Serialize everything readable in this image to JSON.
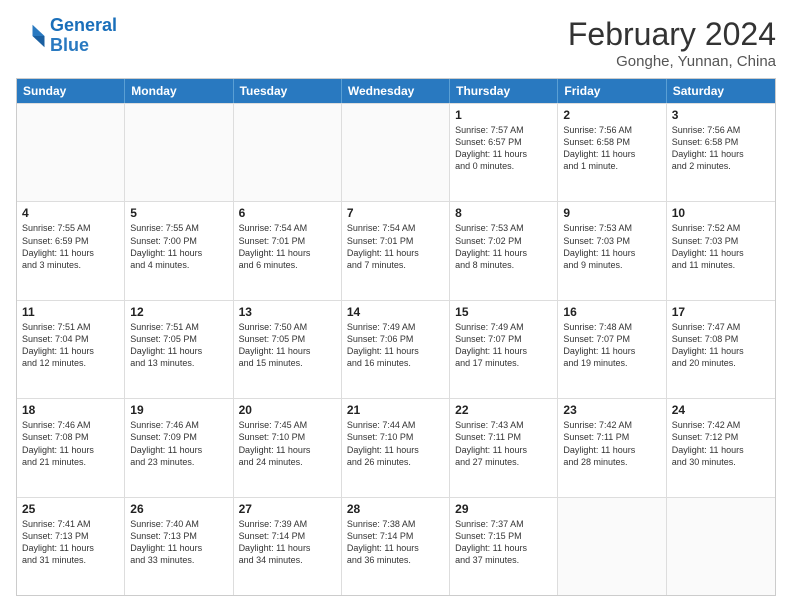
{
  "logo": {
    "line1": "General",
    "line2": "Blue"
  },
  "title": "February 2024",
  "subtitle": "Gonghe, Yunnan, China",
  "days_header": [
    "Sunday",
    "Monday",
    "Tuesday",
    "Wednesday",
    "Thursday",
    "Friday",
    "Saturday"
  ],
  "weeks": [
    [
      {
        "day": "",
        "info": ""
      },
      {
        "day": "",
        "info": ""
      },
      {
        "day": "",
        "info": ""
      },
      {
        "day": "",
        "info": ""
      },
      {
        "day": "1",
        "info": "Sunrise: 7:57 AM\nSunset: 6:57 PM\nDaylight: 11 hours\nand 0 minutes."
      },
      {
        "day": "2",
        "info": "Sunrise: 7:56 AM\nSunset: 6:58 PM\nDaylight: 11 hours\nand 1 minute."
      },
      {
        "day": "3",
        "info": "Sunrise: 7:56 AM\nSunset: 6:58 PM\nDaylight: 11 hours\nand 2 minutes."
      }
    ],
    [
      {
        "day": "4",
        "info": "Sunrise: 7:55 AM\nSunset: 6:59 PM\nDaylight: 11 hours\nand 3 minutes."
      },
      {
        "day": "5",
        "info": "Sunrise: 7:55 AM\nSunset: 7:00 PM\nDaylight: 11 hours\nand 4 minutes."
      },
      {
        "day": "6",
        "info": "Sunrise: 7:54 AM\nSunset: 7:01 PM\nDaylight: 11 hours\nand 6 minutes."
      },
      {
        "day": "7",
        "info": "Sunrise: 7:54 AM\nSunset: 7:01 PM\nDaylight: 11 hours\nand 7 minutes."
      },
      {
        "day": "8",
        "info": "Sunrise: 7:53 AM\nSunset: 7:02 PM\nDaylight: 11 hours\nand 8 minutes."
      },
      {
        "day": "9",
        "info": "Sunrise: 7:53 AM\nSunset: 7:03 PM\nDaylight: 11 hours\nand 9 minutes."
      },
      {
        "day": "10",
        "info": "Sunrise: 7:52 AM\nSunset: 7:03 PM\nDaylight: 11 hours\nand 11 minutes."
      }
    ],
    [
      {
        "day": "11",
        "info": "Sunrise: 7:51 AM\nSunset: 7:04 PM\nDaylight: 11 hours\nand 12 minutes."
      },
      {
        "day": "12",
        "info": "Sunrise: 7:51 AM\nSunset: 7:05 PM\nDaylight: 11 hours\nand 13 minutes."
      },
      {
        "day": "13",
        "info": "Sunrise: 7:50 AM\nSunset: 7:05 PM\nDaylight: 11 hours\nand 15 minutes."
      },
      {
        "day": "14",
        "info": "Sunrise: 7:49 AM\nSunset: 7:06 PM\nDaylight: 11 hours\nand 16 minutes."
      },
      {
        "day": "15",
        "info": "Sunrise: 7:49 AM\nSunset: 7:07 PM\nDaylight: 11 hours\nand 17 minutes."
      },
      {
        "day": "16",
        "info": "Sunrise: 7:48 AM\nSunset: 7:07 PM\nDaylight: 11 hours\nand 19 minutes."
      },
      {
        "day": "17",
        "info": "Sunrise: 7:47 AM\nSunset: 7:08 PM\nDaylight: 11 hours\nand 20 minutes."
      }
    ],
    [
      {
        "day": "18",
        "info": "Sunrise: 7:46 AM\nSunset: 7:08 PM\nDaylight: 11 hours\nand 21 minutes."
      },
      {
        "day": "19",
        "info": "Sunrise: 7:46 AM\nSunset: 7:09 PM\nDaylight: 11 hours\nand 23 minutes."
      },
      {
        "day": "20",
        "info": "Sunrise: 7:45 AM\nSunset: 7:10 PM\nDaylight: 11 hours\nand 24 minutes."
      },
      {
        "day": "21",
        "info": "Sunrise: 7:44 AM\nSunset: 7:10 PM\nDaylight: 11 hours\nand 26 minutes."
      },
      {
        "day": "22",
        "info": "Sunrise: 7:43 AM\nSunset: 7:11 PM\nDaylight: 11 hours\nand 27 minutes."
      },
      {
        "day": "23",
        "info": "Sunrise: 7:42 AM\nSunset: 7:11 PM\nDaylight: 11 hours\nand 28 minutes."
      },
      {
        "day": "24",
        "info": "Sunrise: 7:42 AM\nSunset: 7:12 PM\nDaylight: 11 hours\nand 30 minutes."
      }
    ],
    [
      {
        "day": "25",
        "info": "Sunrise: 7:41 AM\nSunset: 7:13 PM\nDaylight: 11 hours\nand 31 minutes."
      },
      {
        "day": "26",
        "info": "Sunrise: 7:40 AM\nSunset: 7:13 PM\nDaylight: 11 hours\nand 33 minutes."
      },
      {
        "day": "27",
        "info": "Sunrise: 7:39 AM\nSunset: 7:14 PM\nDaylight: 11 hours\nand 34 minutes."
      },
      {
        "day": "28",
        "info": "Sunrise: 7:38 AM\nSunset: 7:14 PM\nDaylight: 11 hours\nand 36 minutes."
      },
      {
        "day": "29",
        "info": "Sunrise: 7:37 AM\nSunset: 7:15 PM\nDaylight: 11 hours\nand 37 minutes."
      },
      {
        "day": "",
        "info": ""
      },
      {
        "day": "",
        "info": ""
      }
    ]
  ]
}
